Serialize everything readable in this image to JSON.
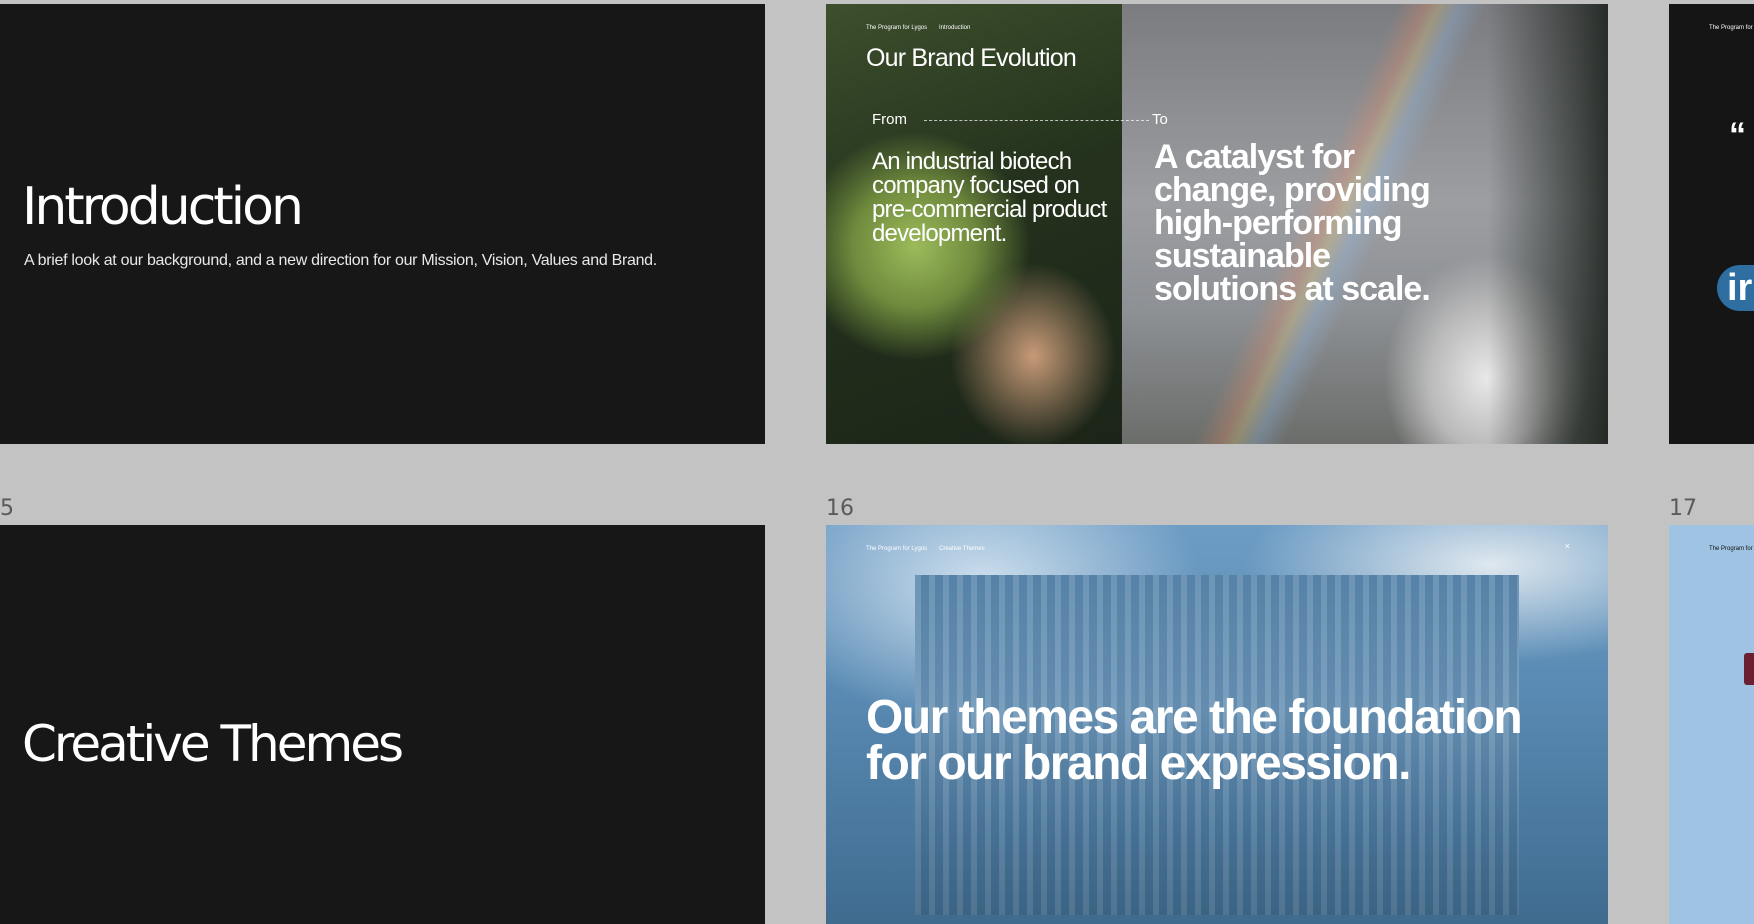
{
  "slides": {
    "intro": {
      "title": "Introduction",
      "subtitle": "A brief look at our background, and a new direction for our Mission, Vision, Values and Brand."
    },
    "brand": {
      "crumb_program": "The Program for Lygos",
      "crumb_section": "Introduction",
      "title": "Our Brand Evolution",
      "from_label": "From",
      "to_label": "To",
      "from_text": "An industrial biotech company focused on pre-commercial product development.",
      "to_text": "A catalyst for change, providing high-performing sustainable solutions at scale."
    },
    "quote_partial": {
      "crumb": "The Program for",
      "quote_mark": "“",
      "pill_text": "ir"
    },
    "themes": {
      "number": "5",
      "title": "Creative Themes"
    },
    "foundation": {
      "number": "16",
      "crumb_program": "The Program for Lygos",
      "crumb_section": "Creative Themes",
      "close": "×",
      "headline": "Our themes are the foundation for our brand expression."
    },
    "right_partial": {
      "number": "17",
      "crumb": "The Program for"
    }
  },
  "colors": {
    "canvas": "#c3c3c3",
    "dark_slide": "#171718",
    "accent_blue": "#2e6ea0"
  }
}
